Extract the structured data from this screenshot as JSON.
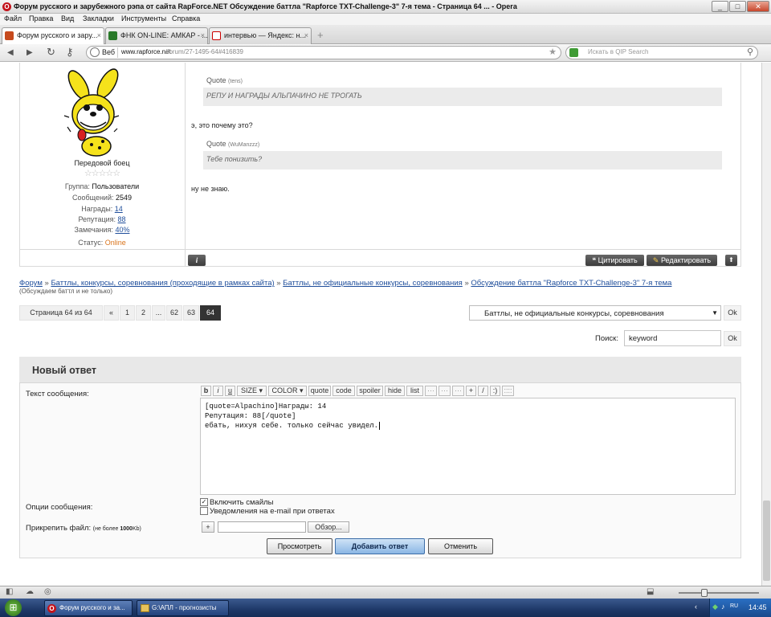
{
  "window": {
    "title": "Форум русского и зарубежного рэпа от сайта RapForce.NET Обсуждение баттла \"Rapforce TXT-Challenge-3\" 7-я тема - Страница 64 ... - Opera",
    "opera_glyph": "O",
    "min_glyph": "_",
    "max_glyph": "□",
    "close_glyph": "✕"
  },
  "menu": [
    "Файл",
    "Правка",
    "Вид",
    "Закладки",
    "Инструменты",
    "Справка"
  ],
  "tabs": [
    {
      "label": "Форум русского и зару...",
      "active": true
    },
    {
      "label": "ФНК ON-LINE: АМКАР - ...",
      "active": false
    },
    {
      "label": "интервью — Яндекс: н...",
      "active": false
    }
  ],
  "tab_close": "×",
  "add_tab": "+",
  "nav": {
    "back": "◀",
    "forward": "▶",
    "reload": "↻",
    "key": "⚷",
    "web_label": "Веб",
    "url_host": "www.rapforce.net",
    "url_path": "/forum/27-1495-64#416839",
    "star": "★",
    "search_placeholder": "Искать в QIP Search",
    "search_go": "⚲"
  },
  "post": {
    "user_rank": "Передовой боец",
    "stars": "☆☆☆☆☆",
    "group_label": "Группа:",
    "group_value": "Пользователи",
    "messages_label": "Сообщений:",
    "messages_value": "2549",
    "awards_label": "Награды:",
    "awards_value": "14",
    "rep_label": "Репутация:",
    "rep_value": "88",
    "warn_label": "Замечания:",
    "warn_value": "40%",
    "status_label": "Статус:",
    "status_value": "Online",
    "quote1_label": "Quote",
    "quote1_author": "(tens)",
    "quote1_text": "РЕПУ И НАГРАДЫ АЛЬПАЧИНО НЕ ТРОГАТЬ",
    "line1": "э, это почему это?",
    "quote2_label": "Quote",
    "quote2_author": "(WuManzzz)",
    "quote2_text": "Тебе понизить?",
    "line2": "ну не знаю.",
    "info_glyph": "i",
    "quote_btn": "Цитировать",
    "quote_btn_icon": "❝",
    "edit_btn": "Редактировать",
    "edit_btn_icon": "✎",
    "up_glyph": "⬆"
  },
  "breadcrumb": {
    "items": [
      "Форум",
      "Баттлы, конкурсы, соревнования (проходящие в рамках сайта)",
      "Баттлы, не официальные конкурсы, соревнования",
      "Обсуждение баттла \"Rapforce TXT-Challenge-3\" 7-я тема"
    ],
    "sep": "»",
    "subtitle": "(Обсуждаем баттл и не только)"
  },
  "pagination": {
    "label": "Страница 64 из 64",
    "prev": "«",
    "pages": [
      "1",
      "2",
      "...",
      "62",
      "63",
      "64"
    ],
    "current": "64"
  },
  "jump": {
    "selected": "Баттлы, не официальные конкурсы, соревнования",
    "arrow": "▼",
    "ok": "Ok"
  },
  "search": {
    "label": "Поиск:",
    "value": "keyword",
    "ok": "Ok"
  },
  "reply": {
    "header": "Новый ответ",
    "message_label": "Текст сообщения:",
    "toolbar": [
      "b",
      "i",
      "u",
      "SIZE ▾",
      "COLOR ▾",
      "quote",
      "code",
      "spoiler",
      "hide",
      "list",
      "···",
      "···",
      "···",
      "+",
      "/",
      ":)",
      "::::"
    ],
    "text_lines": [
      "[quote=Alpachino]Награды: 14",
      "Репутация: 88[/quote]",
      "ебать, нихуя себе. только сейчас увидел."
    ],
    "options_label": "Опции сообщения:",
    "opt_smiles": "Включить смайлы",
    "opt_smiles_checked": true,
    "opt_email": "Уведомления на e-mail при ответах",
    "check_glyph": "✓",
    "attach_label": "Прикрепить файл:",
    "attach_note_prefix": "(не более ",
    "attach_note_size": "1000",
    "attach_note_suffix": "Kb)",
    "attach_add": "+",
    "browse": "Обзор...",
    "preview_btn": "Просмотреть",
    "submit_btn": "Добавить ответ",
    "cancel_btn": "Отменить"
  },
  "statusbar": {
    "glyphs": [
      "◧",
      "☁",
      "◎",
      "⬓"
    ]
  },
  "taskbar": {
    "start_glyph": "⊞",
    "items": [
      {
        "label": "Форум русского и за..."
      },
      {
        "label": "G:\\АПЛ - прогнозисты"
      }
    ],
    "clock": "14:45",
    "tray": [
      "‹",
      "◆",
      "♪",
      "RU"
    ]
  },
  "colors": {
    "link": "#1f4e9b",
    "online": "#d9741c",
    "avatar_yellow": "#f5e21b",
    "submit": "#9fc3ea"
  }
}
